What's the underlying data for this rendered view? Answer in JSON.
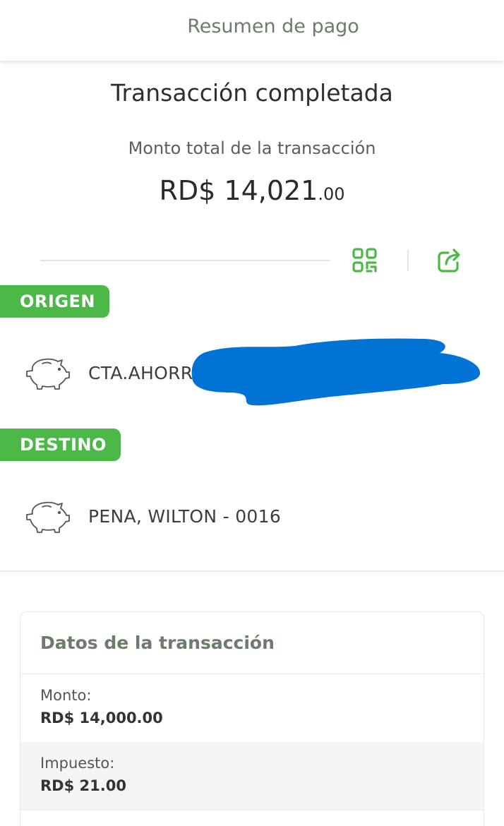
{
  "header": {
    "title": "Resumen de pago"
  },
  "status": {
    "title": "Transacción completada"
  },
  "amount": {
    "label": "Monto total de la transacción",
    "main": "RD$ 14,021",
    "cents": ".00"
  },
  "actions": {
    "qr_icon": "qr-code-icon",
    "share_icon": "share-icon"
  },
  "origin": {
    "tag": "ORIGEN",
    "icon": "piggy-bank-icon",
    "account": "CTA.AHORR"
  },
  "destination": {
    "tag": "DESTINO",
    "icon": "piggy-bank-icon",
    "account": "PENA, WILTON - 0016"
  },
  "details": {
    "title": "Datos de la transacción",
    "rows": [
      {
        "label": "Monto:",
        "value": "RD$ 14,000.00"
      },
      {
        "label": "Impuesto:",
        "value": "RD$ 21.00"
      }
    ]
  },
  "colors": {
    "brand_green": "#4cb848",
    "header_text": "#6b7d6a",
    "redaction_blue": "#0073d4"
  }
}
